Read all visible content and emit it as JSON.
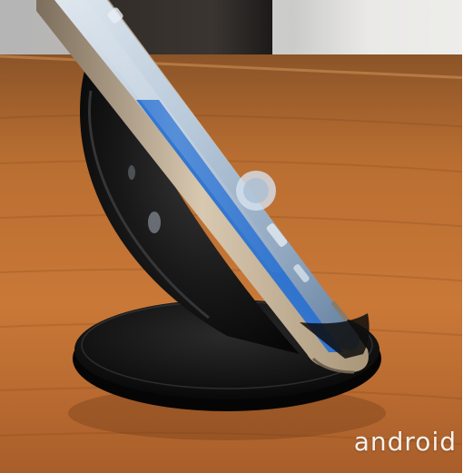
{
  "photo": {
    "subject": "smartphone-on-wireless-charging-stand",
    "colors": {
      "table_wood": "#b86a2c",
      "stand_black": "#151515",
      "screen_blue": "#2b72d0",
      "phone_frame_gold": "#c8b59a"
    }
  },
  "watermark": {
    "text": "android"
  }
}
